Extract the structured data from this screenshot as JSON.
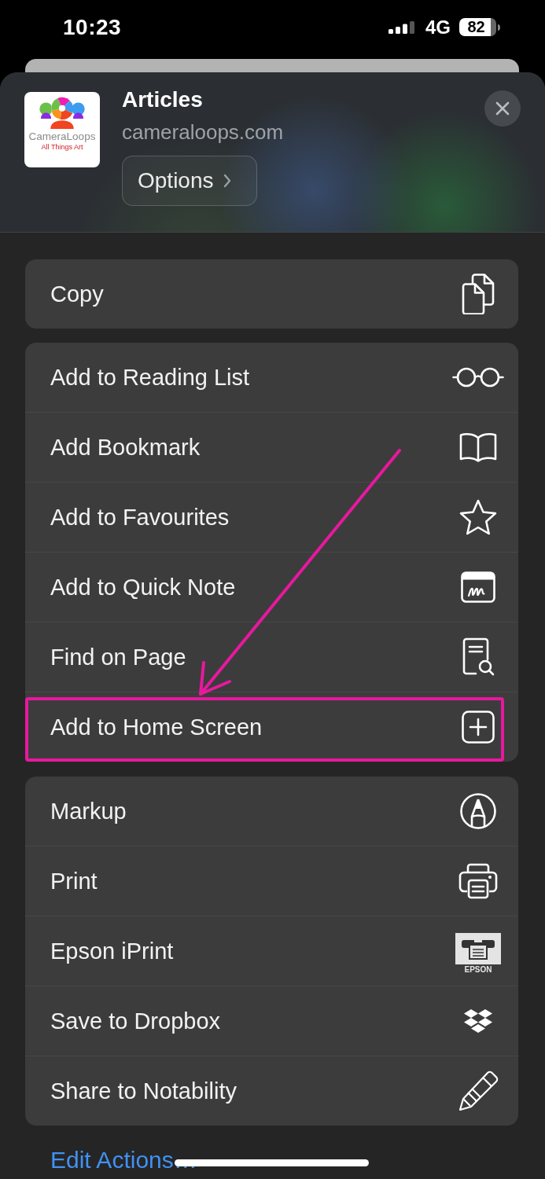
{
  "status_bar": {
    "time": "10:23",
    "network": "4G",
    "battery": "82"
  },
  "header": {
    "logo": {
      "name": "CameraLoops",
      "tagline": "All Things Art"
    },
    "title": "Articles",
    "subtitle": "cameraloops.com",
    "options_button": "Options"
  },
  "groups": [
    {
      "items": [
        {
          "kind": "copy",
          "label": "Copy",
          "highlighted": false
        }
      ]
    },
    {
      "items": [
        {
          "kind": "readinglist",
          "label": "Add to Reading List",
          "highlighted": false
        },
        {
          "kind": "bookmark",
          "label": "Add Bookmark",
          "highlighted": false
        },
        {
          "kind": "favourite",
          "label": "Add to Favourites",
          "highlighted": false
        },
        {
          "kind": "quicknote",
          "label": "Add to Quick Note",
          "highlighted": false
        },
        {
          "kind": "find",
          "label": "Find on Page",
          "highlighted": false
        },
        {
          "kind": "homescreen",
          "label": "Add to Home Screen",
          "highlighted": true
        }
      ]
    },
    {
      "items": [
        {
          "kind": "markup",
          "label": "Markup",
          "highlighted": false
        },
        {
          "kind": "print",
          "label": "Print",
          "highlighted": false
        },
        {
          "kind": "epson",
          "label": "Epson iPrint",
          "icon_caption": "EPSON",
          "highlighted": false
        },
        {
          "kind": "dropbox",
          "label": "Save to Dropbox",
          "highlighted": false
        },
        {
          "kind": "notability",
          "label": "Share to Notability",
          "highlighted": false
        }
      ]
    }
  ],
  "edit_actions": "Edit Actions…"
}
